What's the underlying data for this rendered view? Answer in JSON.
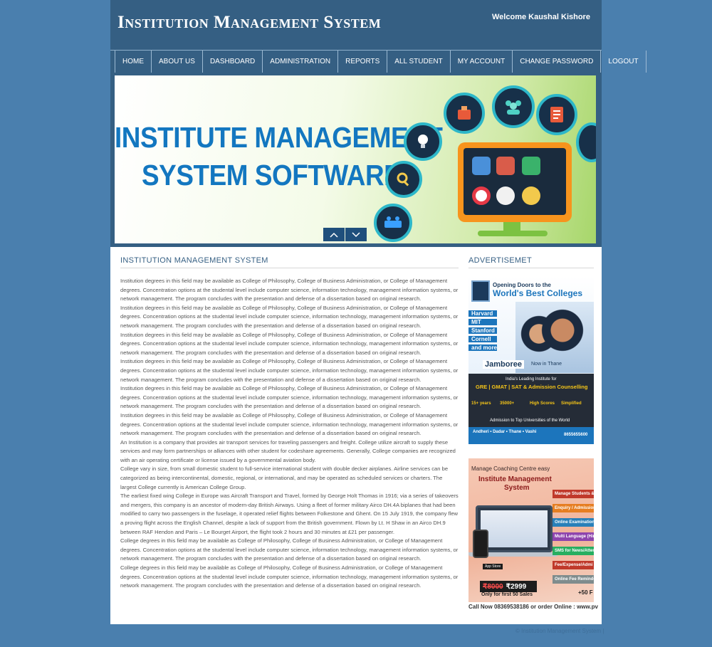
{
  "header": {
    "site_title": "Institution Management System",
    "welcome": "Welcome Kaushal Kishore"
  },
  "nav": {
    "items": [
      {
        "label": "HOME"
      },
      {
        "label": "ABOUT US"
      },
      {
        "label": "DASHBOARD"
      },
      {
        "label": "ADMINISTRATION"
      },
      {
        "label": "REPORTS"
      },
      {
        "label": "ALL STUDENT"
      },
      {
        "label": "MY ACCOUNT"
      },
      {
        "label": "CHANGE PASSWORD"
      },
      {
        "label": "LOGOUT"
      }
    ]
  },
  "banner": {
    "line1": "INSTITUTE MANAGEMENT",
    "line2": "SYSTEM SOFTWARE",
    "prev_icon": "chevron-up-icon",
    "next_icon": "chevron-down-icon"
  },
  "main": {
    "title": "INSTITUTION MANAGEMENT SYSTEM",
    "paragraphs": [
      "Institution degrees in this field may be available as College of Philosophy, College of Business Administration, or College of Management degrees. Concentration options at the studental level include computer science, information technology, management information systems, or network management. The program concludes with the presentation and defense of a dissertation based on original research.",
      "Institution degrees in this field may be available as College of Philosophy, College of Business Administration, or College of Management degrees. Concentration options at the studental level include computer science, information technology, management information systems, or network management. The program concludes with the presentation and defense of a dissertation based on original research.",
      "Institution degrees in this field may be available as College of Philosophy, College of Business Administration, or College of Management degrees. Concentration options at the studental level include computer science, information technology, management information systems, or network management. The program concludes with the presentation and defense of a dissertation based on original research.",
      "Institution degrees in this field may be available as College of Philosophy, College of Business Administration, or College of Management degrees. Concentration options at the studental level include computer science, information technology, management information systems, or network management. The program concludes with the presentation and defense of a dissertation based on original research.",
      "Institution degrees in this field may be available as College of Philosophy, College of Business Administration, or College of Management degrees. Concentration options at the studental level include computer science, information technology, management information systems, or network management. The program concludes with the presentation and defense of a dissertation based on original research.",
      "Institution degrees in this field may be available as College of Philosophy, College of Business Administration, or College of Management degrees. Concentration options at the studental level include computer science, information technology, management information systems, or network management. The program concludes with the presentation and defense of a dissertation based on original research.",
      "An Institution is a company that provides air transport services for traveling passengers and freight. College utilize aircraft to supply these services and may form partnerships or alliances with other student for codeshare agreements. Generally, College companies are recognized with an air operating certificate or license issued by a governmental aviation body.",
      "College vary in size, from small domestic student to full-service international student with double decker airplanes. Airline services can be categorized as being intercontinental, domestic, regional, or international, and may be operated as scheduled services or charters. The largest College currently is American College Group.",
      "The earliest fixed wing College in Europe was Aircraft Transport and Travel, formed by George Holt Thomas in 1916; via a series of takeovers and mergers, this company is an ancestor of modern-day British Airways. Using a fleet of former military Airco DH.4A biplanes that had been modified to carry two passengers in the fuselage, it operated relief flights between Folkestone and Ghent. On 15 July 1919, the company flew a proving flight across the English Channel, despite a lack of support from the British government. Flown by Lt. H Shaw in an Airco DH.9 between RAF Hendon and Paris – Le Bourget Airport, the flight took 2 hours and 30 minutes at £21 per passenger.",
      "College degrees in this field may be available as College of Philosophy, College of Business Administration, or College of Management degrees. Concentration options at the studental level include computer science, information technology, management information systems, or network management. The program concludes with the presentation and defense of a dissertation based on original research.",
      "College degrees in this field may be available as College of Philosophy, College of Business Administration, or College of Management degrees. Concentration options at the studental level include computer science, information technology, management information systems, or network management. The program concludes with the presentation and defense of a dissertation based on original research."
    ]
  },
  "sidebar": {
    "title": "ADVERTISEMET",
    "ad1": {
      "headline_small": "Opening Doors to the",
      "headline_big": "World's Best Colleges",
      "colleges": [
        "Harvard",
        "MIT",
        "Stanford",
        "Cornell",
        "and more.."
      ],
      "brand": "Jamboree",
      "location": "Now in Thane",
      "tagline": "India's Leading Institute for",
      "courses": "GRE | GMAT | SAT & Admission Counselling",
      "stats": [
        "15+ years",
        "35000+",
        "High Scores",
        "Simplified"
      ],
      "bottom_line": "Admission to Top Universities of the World",
      "branches": "Andheri • Dadar • Thane • Vashi",
      "phone": "8655655600"
    },
    "ad2": {
      "top_line": "Manage Coaching Centre easy",
      "title_line1": "Institute Management",
      "title_line2": "System",
      "features": [
        "Manage Students &",
        "Enquiry / Admission",
        "Online Examination",
        "Multi Language (Hin",
        "SMS for News/Atten",
        "Fee/Expense/Admi",
        "Online Fee Reminde"
      ],
      "app_badge": "App Store",
      "old_price": "₹8000",
      "new_price": "₹2999",
      "offer": "Only for first 50 Sales",
      "plus": "+50 F",
      "call": "Call Now 08369538186 or order Online : www.pv"
    }
  },
  "footer": {
    "text": "© Institution Management System |"
  },
  "colors": {
    "page_bg": "#4a7fae",
    "header_bg": "#355f83",
    "accent_blue": "#1377c0"
  }
}
